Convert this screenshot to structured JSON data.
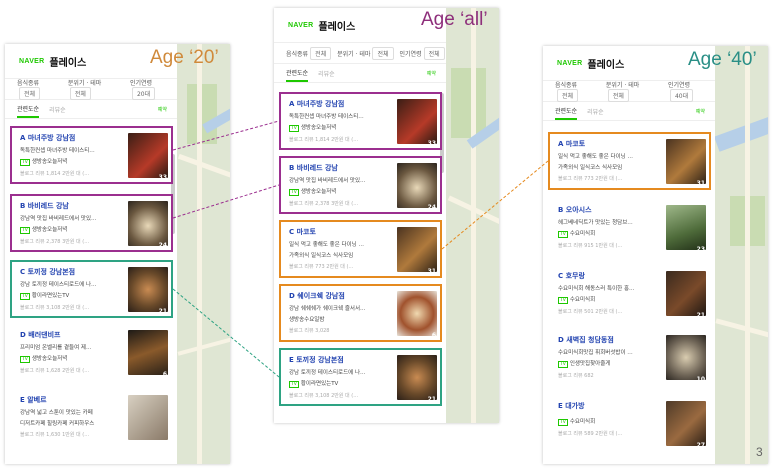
{
  "brand": {
    "naver": "NAVER",
    "place": "플레이스"
  },
  "colors": {
    "purple": "#9b2f8f",
    "teal": "#2ea383",
    "orange": "#e58a1f",
    "naver_green": "#1ec800",
    "title_blue": "#2243b0"
  },
  "panels": {
    "p20": {
      "age_label": "Age ‘20’",
      "filters": [
        {
          "label": "음식종류",
          "value": "전체"
        },
        {
          "label": "분위기 · 테마",
          "value": "전체"
        },
        {
          "label": "인기연령",
          "value": "20대"
        }
      ],
      "tabs": {
        "active": "관련도순",
        "other": "리뷰순",
        "reserve": "예약"
      },
      "items": [
        {
          "title": "A 마녀주방 강남점",
          "desc": "독특한컨셉 마녀주방 테이스티…",
          "tv": "생방송오늘저녁",
          "meta": "블로그 리뷰 1,814    2만원 대 (…",
          "count": "33"
        },
        {
          "title": "B 바비레드 강남",
          "desc": "강남역 맛집 바비레드에서 맛있…",
          "tv": "생방송오늘저녁",
          "meta": "블로그 리뷰 2,378    3만원 대 (…",
          "count": "24"
        },
        {
          "title": "C 토끼정 강남본점",
          "desc": "강남 토끼정 테이스티로드에 나…",
          "tv": "황이라면있는TV",
          "meta": "블로그 리뷰 3,108    2만원 대 (…",
          "count": "21"
        },
        {
          "title": "D 배러댄비프",
          "desc": "프리미엄 온벨리를 곁들여 제…",
          "tv": "생방송오늘저녁",
          "meta": "블로그 리뷰 1,628    2만원 대 (…",
          "count": "6"
        },
        {
          "title": "E 알베르",
          "desc": "강남역 넓고 스툰이 맛있는 카페",
          "tv": "디저트카페  힐링카페  커피하우스",
          "meta": "블로그 리뷰 1,630    1만원 대 (…",
          "count": ""
        }
      ]
    },
    "pall": {
      "age_label": "Age ‘all’",
      "filters": [
        {
          "label": "음식종류",
          "value": "전체"
        },
        {
          "label": "분위기 · 테마",
          "value": "전체"
        },
        {
          "label": "인기연령",
          "value": "전체"
        }
      ],
      "tabs": {
        "active": "관련도순",
        "other": "리뷰순",
        "reserve": "예약"
      },
      "items": [
        {
          "title": "A 마녀주방 강남점",
          "desc": "독특한컨셉 마녀주방 테이스티…",
          "tv": "생방송오늘저녁",
          "meta": "블로그 리뷰 1,814    2만원 대 (…",
          "count": "33"
        },
        {
          "title": "B 바비레드 강남",
          "desc": "강남역 맛집 바비레드에서 맛있…",
          "tv": "생방송오늘저녁",
          "meta": "블로그 리뷰 2,378    3만원 대 (…",
          "count": "24"
        },
        {
          "title": "C 마코토",
          "desc": "일식 먹고 좋해도 좋은 다이닝 …",
          "tv": "가족외식  일식코스  식사모임",
          "meta": "블로그 리뷰 773    2만원 대 (…",
          "count": "31"
        },
        {
          "title": "D 쉐이크쉑 강남점",
          "desc": "강남 쉐쉐쉐가 쉐이크쉑 즐서서…",
          "tv": "생방송수요일밤",
          "meta": "블로그 리뷰 3,028",
          "count": "6"
        },
        {
          "title": "E 토끼정 강남본점",
          "desc": "강남 토끼정 테이스티로드에 나…",
          "tv": "황이라면있는TV",
          "meta": "블로그 리뷰 3,108    2만원 대 (…",
          "count": "21"
        }
      ]
    },
    "p40": {
      "age_label": "Age ‘40’",
      "filters": [
        {
          "label": "음식종류",
          "value": "전체"
        },
        {
          "label": "분위기 · 테마",
          "value": "전체"
        },
        {
          "label": "인기연령",
          "value": "40대"
        }
      ],
      "tabs": {
        "active": "관련도순",
        "other": "리뷰순",
        "reserve": "예약"
      },
      "items": [
        {
          "title": "A 마코토",
          "desc": "일식 먹고 좋해도 좋은 다이닝 …",
          "tv": "가족외식  일식코스  식사모임",
          "meta": "블로그 리뷰 773    2만원 대 (…",
          "count": "31"
        },
        {
          "title": "B 오아시스",
          "desc": "헤그베네딕트가 맛있는 청담브…",
          "tv": "수요미식회",
          "meta": "블로그 리뷰 915    1만원 대 (…",
          "count": "23"
        },
        {
          "title": "C 호무랑",
          "desc": "수요미식회 해동스러 특이한 홍…",
          "tv": "수요미식회",
          "meta": "블로그 리뷰 501    2만원 대 (…",
          "count": "21"
        },
        {
          "title": "D 새벽집 청담동점",
          "desc": "수요미식회맛집 휘회버섯밥이 …",
          "tv": "인생맛집찾아줄게",
          "meta": "블로그 리뷰 682",
          "count": "10"
        },
        {
          "title": "E 대가방",
          "desc": "",
          "tv": "수요미식회",
          "meta": "블로그 리뷰 589    2만원 대 (…",
          "count": "27"
        }
      ]
    }
  },
  "page_number": "3"
}
